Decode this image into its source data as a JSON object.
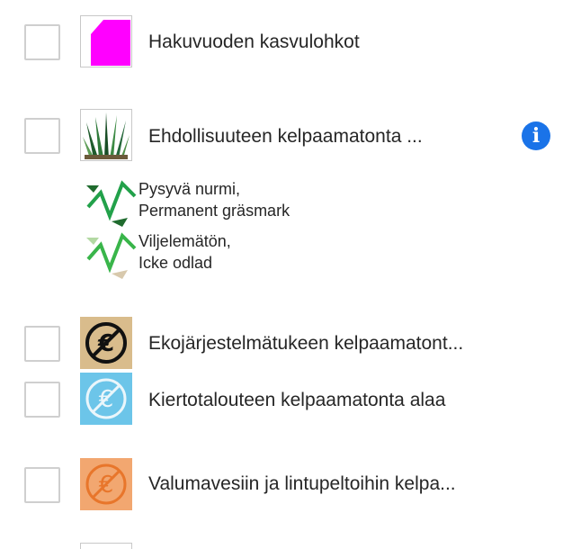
{
  "layers": [
    {
      "id": "hakuvuoden",
      "label": "Hakuvuoden kasvulohkot",
      "icon": "magenta-polygon-icon",
      "checked": false
    },
    {
      "id": "ehdollisuus",
      "label": "Ehdollisuuteen kelpaamatonta ...",
      "icon": "grass-icon",
      "checked": false,
      "info_icon": "info-icon",
      "legend": [
        {
          "icon": "green-arrow-line-icon",
          "line1": "Pysyvä nurmi,",
          "line2": "Permanent gräsmark"
        },
        {
          "icon": "pale-arrow-line-icon",
          "line1": "Viljelemätön,",
          "line2": "Icke odlad"
        }
      ]
    },
    {
      "id": "ekojarjestelma",
      "label": "Ekojärjestelmätukeen kelpaamatont...",
      "icon": "euro-crossed-black-icon",
      "checked": false
    },
    {
      "id": "kiertotalous",
      "label": "Kiertotalouteen kelpaamatonta alaa",
      "icon": "euro-crossed-blue-icon",
      "checked": false
    },
    {
      "id": "valumavesi",
      "label": "Valumavesiin ja lintupeltoihin kelpa...",
      "icon": "euro-crossed-orange-icon",
      "checked": false
    }
  ],
  "colors": {
    "magenta": "#ff00ff",
    "info_blue": "#1a73e8",
    "tan": "#d9bc8c",
    "light_blue": "#6cc5e9",
    "orange_bg": "#f2a770",
    "green_arrow": "#1a9b3c"
  }
}
